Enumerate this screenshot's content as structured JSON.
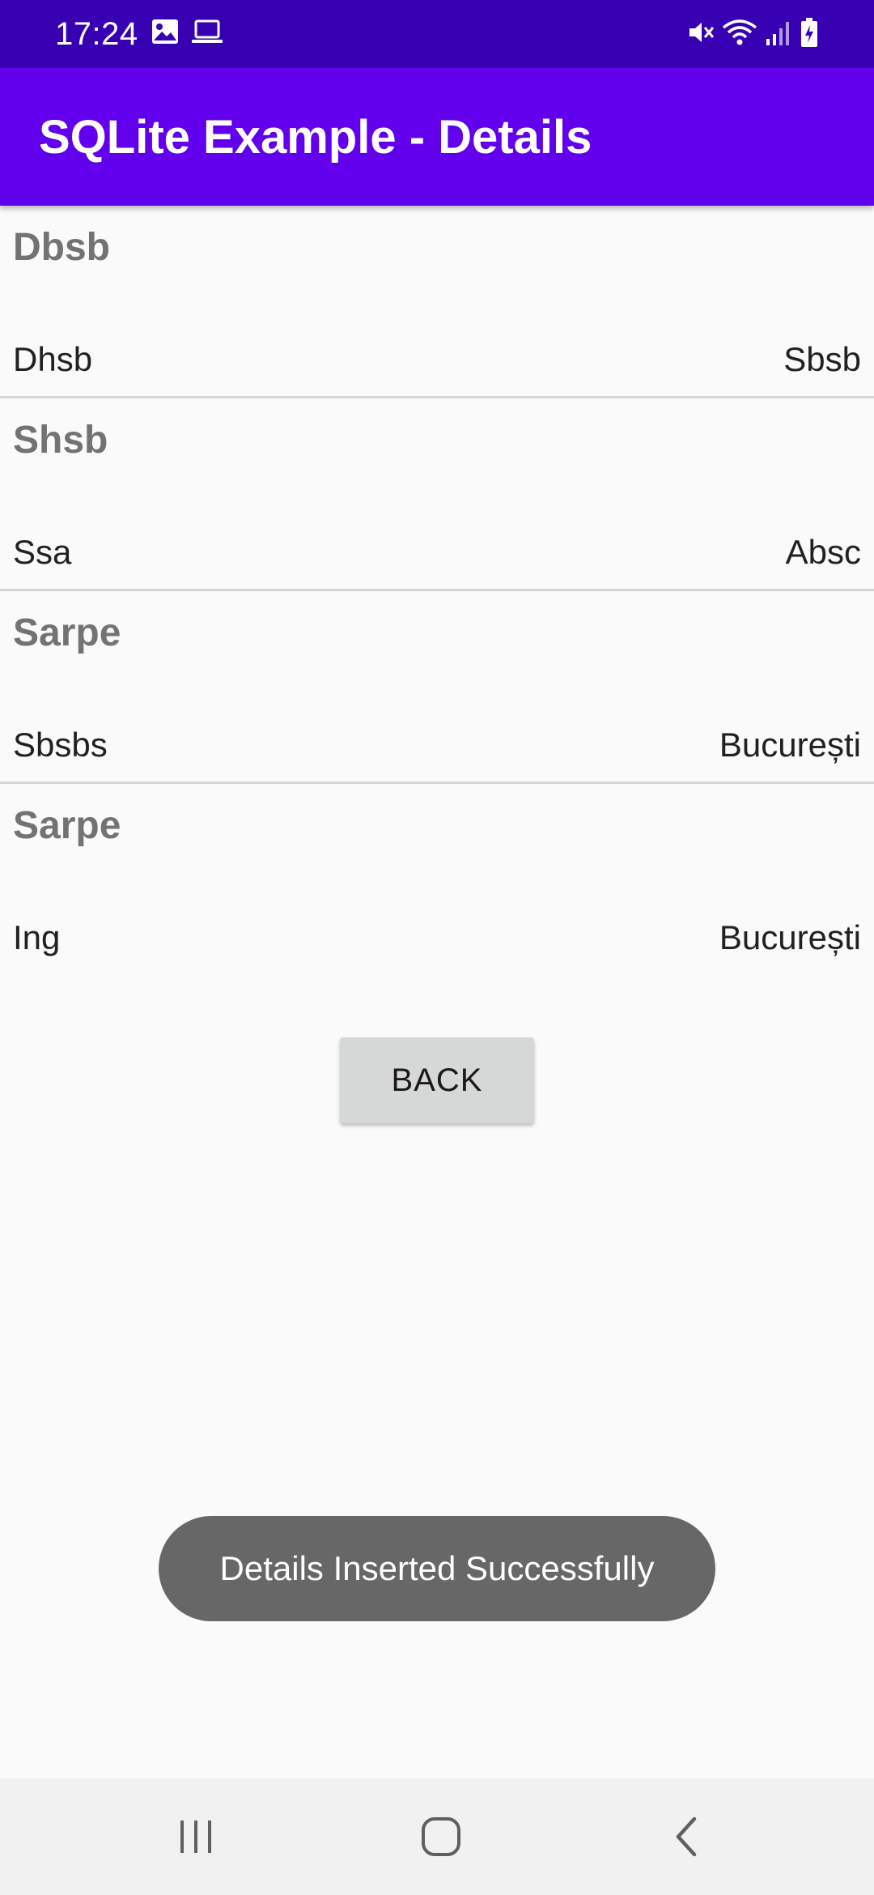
{
  "status_bar": {
    "time": "17:24",
    "left_icons": [
      "image-icon",
      "laptop-icon"
    ],
    "right_icons": [
      "mute-icon",
      "wifi-icon",
      "signal-icon",
      "battery-icon"
    ]
  },
  "app_bar": {
    "title": "SQLite Example - Details"
  },
  "details": [
    {
      "name": "Dbsb",
      "designation": "Dhsb",
      "location": "Sbsb"
    },
    {
      "name": "Shsb",
      "designation": "Ssa",
      "location": "Absc"
    },
    {
      "name": "Sarpe",
      "designation": "Sbsbs",
      "location": "București"
    },
    {
      "name": "Sarpe",
      "designation": "Ing",
      "location": "București"
    }
  ],
  "back_button": {
    "label": "BACK"
  },
  "toast": {
    "message": "Details Inserted Successfully"
  },
  "nav_bar": {
    "icons": [
      "recents-icon",
      "home-icon",
      "back-icon"
    ]
  },
  "colors": {
    "status_bar": "#3700b3",
    "app_bar": "#6200ee",
    "background": "#fafafa",
    "toast": "#676767",
    "button": "#d6d7d7"
  }
}
